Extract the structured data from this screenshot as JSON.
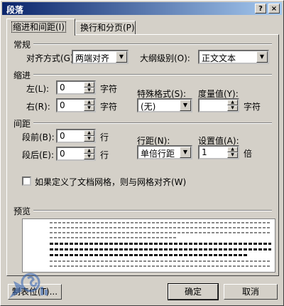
{
  "window": {
    "title": "段落",
    "help_btn": "?",
    "close_btn": "×"
  },
  "tabs": [
    {
      "label": "缩进和间距(I)"
    },
    {
      "label": "换行和分页(P)"
    }
  ],
  "general": {
    "section": "常规",
    "alignment_label": "对齐方式(G):",
    "alignment_value": "两端对齐",
    "outline_label": "大纲级别(O):",
    "outline_value": "正文文本"
  },
  "indent": {
    "section": "缩进",
    "left_label": "左(L):",
    "left_value": "0",
    "left_unit": "字符",
    "right_label": "右(R):",
    "right_value": "0",
    "right_unit": "字符",
    "special_label": "特殊格式(S):",
    "special_value": "(无)",
    "measure_label": "度量值(Y):",
    "measure_value": "",
    "measure_unit": "字符"
  },
  "spacing": {
    "section": "间距",
    "before_label": "段前(B):",
    "before_value": "0",
    "before_unit": "行",
    "after_label": "段后(E):",
    "after_value": "0",
    "after_unit": "行",
    "line_label": "行距(N):",
    "line_value": "单倍行距",
    "setting_label": "设置值(A):",
    "setting_value": "1",
    "setting_unit": "倍"
  },
  "grid_checkbox_label": "如果定义了文档网格，则与网格对齐(W)",
  "preview_section": "预览",
  "buttons": {
    "tabs": "制表位(T)...",
    "ok": "确定",
    "cancel": "取消"
  },
  "colors": {
    "title_bar": "#0a246a",
    "face": "#d4d0c8",
    "watermark": "#2a5db0"
  }
}
